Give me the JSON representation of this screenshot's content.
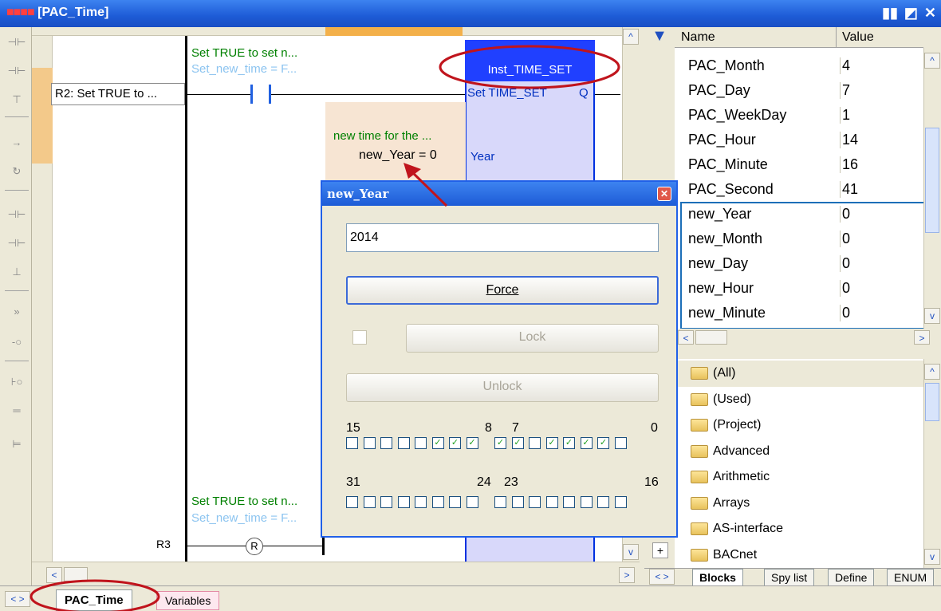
{
  "window": {
    "title": "[PAC_Time]",
    "title_dots": "■■■■"
  },
  "ladder": {
    "r2_label": "R2: Set TRUE to ...",
    "comment1": "Set TRUE to set n...",
    "var1": "Set_new_time = F...",
    "fb_instance": "Inst_TIME_SET",
    "fb_type": "Set TIME_SET",
    "fb_out": "Q",
    "note": "new time for the ...",
    "input_binding": "new_Year = 0",
    "fb_input": "Year",
    "comment2": "Set TRUE to set n...",
    "var2": "Set_new_time = F...",
    "r3_label": "R3",
    "coil": "R"
  },
  "dialog": {
    "title": "new_Year",
    "value": "2014",
    "force": "Force",
    "lock": "Lock",
    "unlock": "Unlock",
    "bits1": {
      "a": "15",
      "b": "8",
      "c": "7",
      "d": "0",
      "checked": [
        0,
        0,
        0,
        0,
        0,
        1,
        1,
        1,
        1,
        1,
        0,
        1,
        1,
        1,
        1,
        0
      ]
    },
    "bits2": {
      "a": "31",
      "b": "24",
      "c": "23",
      "d": "16",
      "checked": [
        0,
        0,
        0,
        0,
        0,
        0,
        0,
        0,
        0,
        0,
        0,
        0,
        0,
        0,
        0,
        0
      ]
    }
  },
  "vars": {
    "header_name": "Name",
    "header_value": "Value",
    "rows": [
      {
        "name": "PAC_Month",
        "value": "4"
      },
      {
        "name": "PAC_Day",
        "value": "7"
      },
      {
        "name": "PAC_WeekDay",
        "value": "1"
      },
      {
        "name": "PAC_Hour",
        "value": "14"
      },
      {
        "name": "PAC_Minute",
        "value": "16"
      },
      {
        "name": "PAC_Second",
        "value": "41"
      },
      {
        "name": "new_Year",
        "value": "0"
      },
      {
        "name": "new_Month",
        "value": "0"
      },
      {
        "name": "new_Day",
        "value": "0"
      },
      {
        "name": "new_Hour",
        "value": "0"
      },
      {
        "name": "new_Minute",
        "value": "0"
      }
    ]
  },
  "library": {
    "items": [
      "(All)",
      "(Used)",
      "(Project)",
      "Advanced",
      "Arithmetic",
      "Arrays",
      "AS-interface",
      "BACnet"
    ],
    "tabs": [
      "Blocks",
      "Spy list",
      "Define",
      "ENUM"
    ]
  },
  "bottom_tabs": [
    "PAC_Time",
    "Variables"
  ],
  "colors": {
    "annotation": "#c0141c",
    "highlight_box": "#1c6fb8",
    "fb_header": "#2040ff"
  }
}
